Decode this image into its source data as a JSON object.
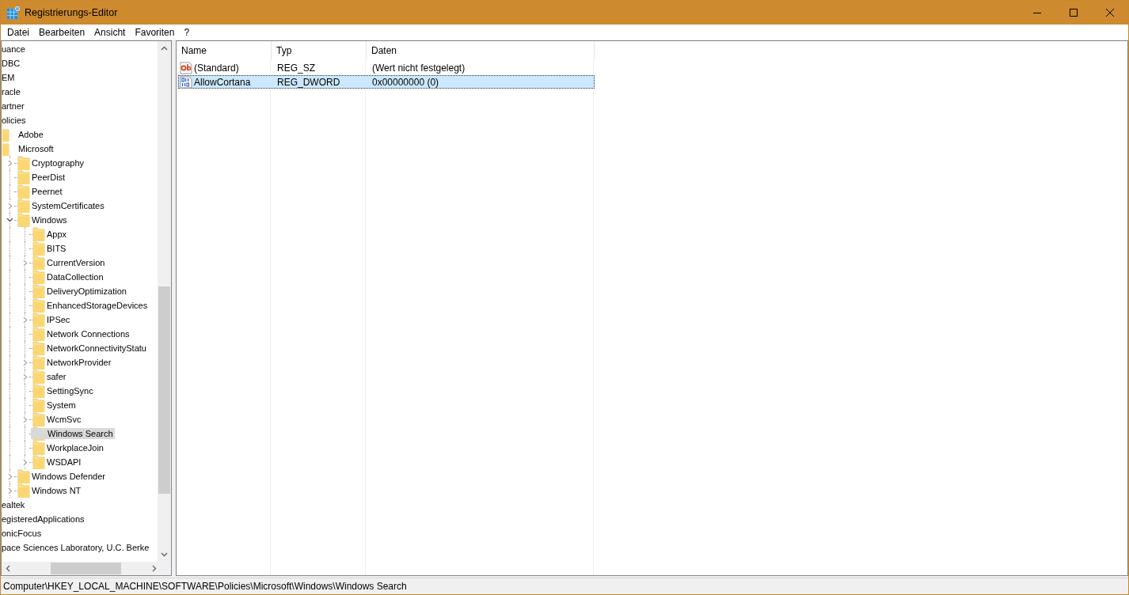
{
  "window": {
    "title": "Registrierungs-Editor"
  },
  "menu": [
    "Datei",
    "Bearbeiten",
    "Ansicht",
    "Favoriten",
    "?"
  ],
  "tree": [
    {
      "label": "uance",
      "selected": false
    },
    {
      "label": "DBC",
      "selected": false
    },
    {
      "label": "EM",
      "selected": false
    },
    {
      "label": "racle",
      "selected": false
    },
    {
      "label": "artner",
      "selected": false
    },
    {
      "label": "olicies",
      "selected": false,
      "children": [
        {
          "label": "Adobe",
          "selected": false
        },
        {
          "label": "Microsoft",
          "selected": false,
          "children": [
            {
              "label": "Cryptography",
              "selected": false,
              "expanded": false
            },
            {
              "label": "PeerDist",
              "selected": false
            },
            {
              "label": "Peernet",
              "selected": false
            },
            {
              "label": "SystemCertificates",
              "selected": false,
              "expanded": false
            },
            {
              "label": "Windows",
              "selected": false,
              "expanded": true,
              "children": [
                {
                  "label": "Appx",
                  "selected": false
                },
                {
                  "label": "BITS",
                  "selected": false
                },
                {
                  "label": "CurrentVersion",
                  "selected": false,
                  "expanded": false
                },
                {
                  "label": "DataCollection",
                  "selected": false
                },
                {
                  "label": "DeliveryOptimization",
                  "selected": false
                },
                {
                  "label": "EnhancedStorageDevices",
                  "selected": false
                },
                {
                  "label": "IPSec",
                  "selected": false,
                  "expanded": false
                },
                {
                  "label": "Network Connections",
                  "selected": false
                },
                {
                  "label": "NetworkConnectivityStatu",
                  "selected": false
                },
                {
                  "label": "NetworkProvider",
                  "selected": false,
                  "expanded": false
                },
                {
                  "label": "safer",
                  "selected": false,
                  "expanded": false
                },
                {
                  "label": "SettingSync",
                  "selected": false
                },
                {
                  "label": "System",
                  "selected": false
                },
                {
                  "label": "WcmSvc",
                  "selected": false,
                  "expanded": false
                },
                {
                  "label": "Windows Search",
                  "selected": true
                },
                {
                  "label": "WorkplaceJoin",
                  "selected": false
                },
                {
                  "label": "WSDAPI",
                  "selected": false,
                  "expanded": false
                }
              ]
            },
            {
              "label": "Windows Defender",
              "selected": false,
              "expanded": false
            },
            {
              "label": "Windows NT",
              "selected": false,
              "expanded": false
            }
          ]
        }
      ]
    },
    {
      "label": "ealtek",
      "selected": false
    },
    {
      "label": "egisteredApplications",
      "selected": false
    },
    {
      "label": "onicFocus",
      "selected": false
    },
    {
      "label": "pace Sciences Laboratory, U.C. Berke",
      "selected": false
    }
  ],
  "values_table": {
    "columns": [
      "Name",
      "Typ",
      "Daten"
    ],
    "rows": [
      {
        "kind": "string",
        "name": "(Standard)",
        "type": "REG_SZ",
        "data": "(Wert nicht festgelegt)",
        "selected": false
      },
      {
        "kind": "binary",
        "name": "AllowCortana",
        "type": "REG_DWORD",
        "data": "0x00000000 (0)",
        "selected": true
      }
    ]
  },
  "status_bar": "Computer\\HKEY_LOCAL_MACHINE\\SOFTWARE\\Policies\\Microsoft\\Windows\\Windows Search"
}
